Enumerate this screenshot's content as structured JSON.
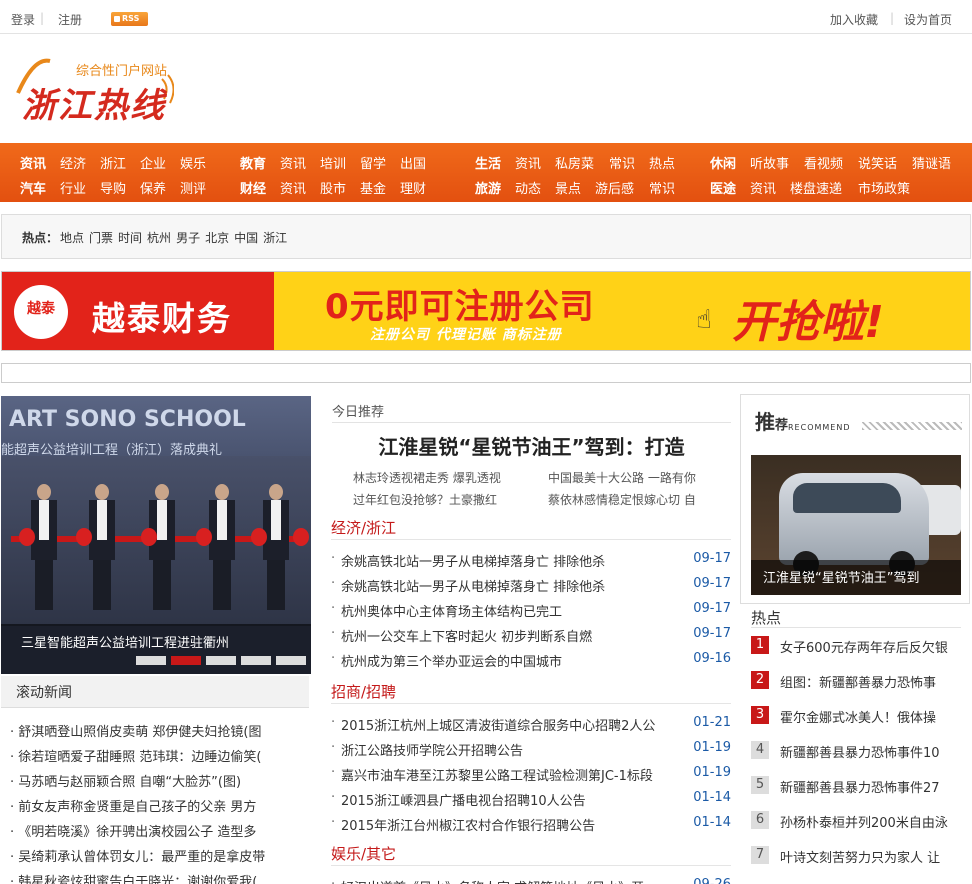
{
  "topbar": {
    "login": "登录",
    "register": "注册",
    "rss": "RSS",
    "favorite": "加入收藏",
    "homepage": "设为首页"
  },
  "logo": {
    "slogan": "综合性门户网站",
    "text": "浙江热线"
  },
  "nav": {
    "row1": [
      {
        "label": "资讯",
        "bold": true
      },
      {
        "label": "经济"
      },
      {
        "label": "浙江"
      },
      {
        "label": "企业"
      },
      {
        "label": "娱乐"
      },
      {
        "label": "教育",
        "bold": true
      },
      {
        "label": "资讯"
      },
      {
        "label": "培训"
      },
      {
        "label": "留学"
      },
      {
        "label": "出国"
      },
      {
        "label": "生活",
        "bold": true
      },
      {
        "label": "资讯"
      },
      {
        "label": "私房菜"
      },
      {
        "label": "常识"
      },
      {
        "label": "热点"
      },
      {
        "label": "休闲",
        "bold": true
      },
      {
        "label": "听故事"
      },
      {
        "label": "看视频"
      },
      {
        "label": "说笑话"
      },
      {
        "label": "猜谜语"
      }
    ],
    "row2": [
      {
        "label": "汽车",
        "bold": true
      },
      {
        "label": "行业"
      },
      {
        "label": "导购"
      },
      {
        "label": "保养"
      },
      {
        "label": "测评"
      },
      {
        "label": "财经",
        "bold": true
      },
      {
        "label": "资讯"
      },
      {
        "label": "股市"
      },
      {
        "label": "基金"
      },
      {
        "label": "理财"
      },
      {
        "label": "旅游",
        "bold": true
      },
      {
        "label": "动态"
      },
      {
        "label": "景点"
      },
      {
        "label": "游后感"
      },
      {
        "label": "常识"
      },
      {
        "label": "医途",
        "bold": true
      },
      {
        "label": "资讯"
      },
      {
        "label": "楼盘速递"
      },
      {
        "label": "市场政策"
      }
    ]
  },
  "hot": {
    "label": "热点：",
    "words": [
      "地点",
      "门票",
      "时间",
      "杭州",
      "男子",
      "北京",
      "中国",
      "浙江"
    ]
  },
  "banner": {
    "brand_mark": "越泰",
    "brand": "越泰财务",
    "main": "0元即可注册公司",
    "sub": "注册公司  代理记账  商标注册",
    "cta": "开抢啦!"
  },
  "slide": {
    "school": "ART SONO SCHOOL",
    "subtitle": "能超声公益培训工程（浙江）落成典礼",
    "caption": "三星智能超声公益培训工程进驻衢州",
    "active_dot": 1,
    "dot_count": 5
  },
  "scroll": {
    "title": "滚动新闻",
    "items": [
      "· 舒淇晒登山照俏皮卖萌 郑伊健夫妇抢镜(图",
      "· 徐若瑄晒爱子甜睡照 范玮琪：边睡边偷笑(",
      "· 马苏晒与赵丽颖合照 自嘲“大脸苏”(图)",
      "· 前女友声称金贤重是自己孩子的父亲 男方",
      "· 《明若晓溪》徐开骋出演校园公子 造型多",
      "· 吴绮莉承认曾体罚女儿：最严重的是拿皮带",
      "· 韩星秋瓷炫甜蜜告白于晓光：谢谢你爱我("
    ]
  },
  "recommend": {
    "head": "今日推荐",
    "feature": "江淮星锐“星锐节油王”驾到：打造",
    "links": [
      "林志玲透视裙走秀 爆乳透视",
      "中国最美十大公路 一路有你",
      "过年红包没抢够？土豪撒红",
      "蔡依林感情稳定恨嫁心切 自"
    ]
  },
  "sections": [
    {
      "title": "经济/浙江",
      "items": [
        {
          "t": "余姚高铁北站一男子从电梯掉落身亡 排除他杀",
          "d": "09-17"
        },
        {
          "t": "余姚高铁北站一男子从电梯掉落身亡 排除他杀",
          "d": "09-17"
        },
        {
          "t": "杭州奥体中心主体育场主体结构已完工",
          "d": "09-17"
        },
        {
          "t": "杭州一公交车上下客时起火 初步判断系自燃",
          "d": "09-17"
        },
        {
          "t": "杭州成为第三个举办亚运会的中国城市",
          "d": "09-16"
        }
      ]
    },
    {
      "title": "招商/招聘",
      "items": [
        {
          "t": "2015浙江杭州上城区清波街道综合服务中心招聘2人公",
          "d": "01-21"
        },
        {
          "t": "浙江公路技师学院公开招聘公告",
          "d": "01-19"
        },
        {
          "t": "嘉兴市油车港至江苏黎里公路工程试验检测第JC-1标段",
          "d": "01-19"
        },
        {
          "t": "2015浙江嵊泗县广播电视台招聘10人公告",
          "d": "01-14"
        },
        {
          "t": "2015年浙江台州椒江农村合作银行招聘公告",
          "d": "01-14"
        }
      ]
    },
    {
      "title": "娱乐/其它",
      "items": [
        {
          "t": "好汉出道首《风水》名称人字 求解答地址《风水》开",
          "d": "09-26"
        }
      ]
    }
  ],
  "right": {
    "rec_title": "推",
    "rec_title2": "荐",
    "rec_sub": "RECOMMEND",
    "rec_caption": "江淮星锐“星锐节油王”驾到",
    "hot_head": "热点",
    "hot_items": [
      {
        "n": "1",
        "t": "女子600元存两年存后反欠银"
      },
      {
        "n": "2",
        "t": "组图：新疆鄯善暴力恐怖事"
      },
      {
        "n": "3",
        "t": "霍尔金娜式冰美人！俄体操"
      },
      {
        "n": "4",
        "t": "新疆鄯善县暴力恐怖事件10"
      },
      {
        "n": "5",
        "t": "新疆鄯善县暴力恐怖事件27"
      },
      {
        "n": "6",
        "t": "孙杨朴泰桓并列200米自由泳"
      },
      {
        "n": "7",
        "t": "叶诗文刻苦努力只为家人 让"
      }
    ]
  }
}
